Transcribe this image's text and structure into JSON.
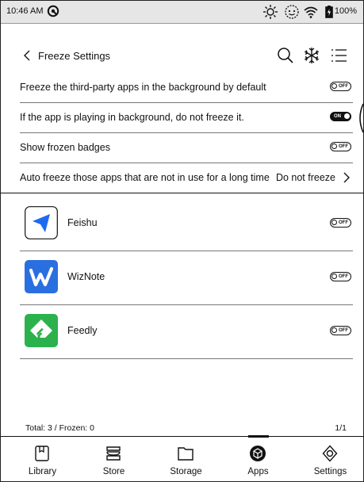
{
  "status_bar": {
    "time": "10:46 AM",
    "battery": "100%"
  },
  "header": {
    "back_icon": "chevron-left-icon",
    "title": "Freeze Settings",
    "actions": [
      "search-icon",
      "freeze-snowflake-icon",
      "list-menu-icon"
    ]
  },
  "settings": [
    {
      "label": "Freeze the third-party apps in the background by default",
      "toggle": "OFF"
    },
    {
      "label": "If the app is playing in background, do not freeze it.",
      "toggle": "ON"
    },
    {
      "label": "Show frozen badges",
      "toggle": "OFF"
    },
    {
      "label": "Auto freeze those apps that are not in use for a long time",
      "value": "Do not freeze"
    }
  ],
  "apps": [
    {
      "name": "Feishu",
      "toggle": "OFF",
      "icon_color": "#1f6bf0"
    },
    {
      "name": "WizNote",
      "toggle": "OFF",
      "icon_color": "#2a6fe0"
    },
    {
      "name": "Feedly",
      "toggle": "OFF",
      "icon_color": "#2bb24c"
    }
  ],
  "footer": {
    "total": "Total: 3 / Frozen: 0",
    "pages": "1/1"
  },
  "tabs": [
    {
      "label": "Library",
      "icon": "book-icon",
      "active": false
    },
    {
      "label": "Store",
      "icon": "store-icon",
      "active": false
    },
    {
      "label": "Storage",
      "icon": "folder-icon",
      "active": false
    },
    {
      "label": "Apps",
      "icon": "cube-icon",
      "active": true
    },
    {
      "label": "Settings",
      "icon": "gear-icon",
      "active": false
    }
  ]
}
